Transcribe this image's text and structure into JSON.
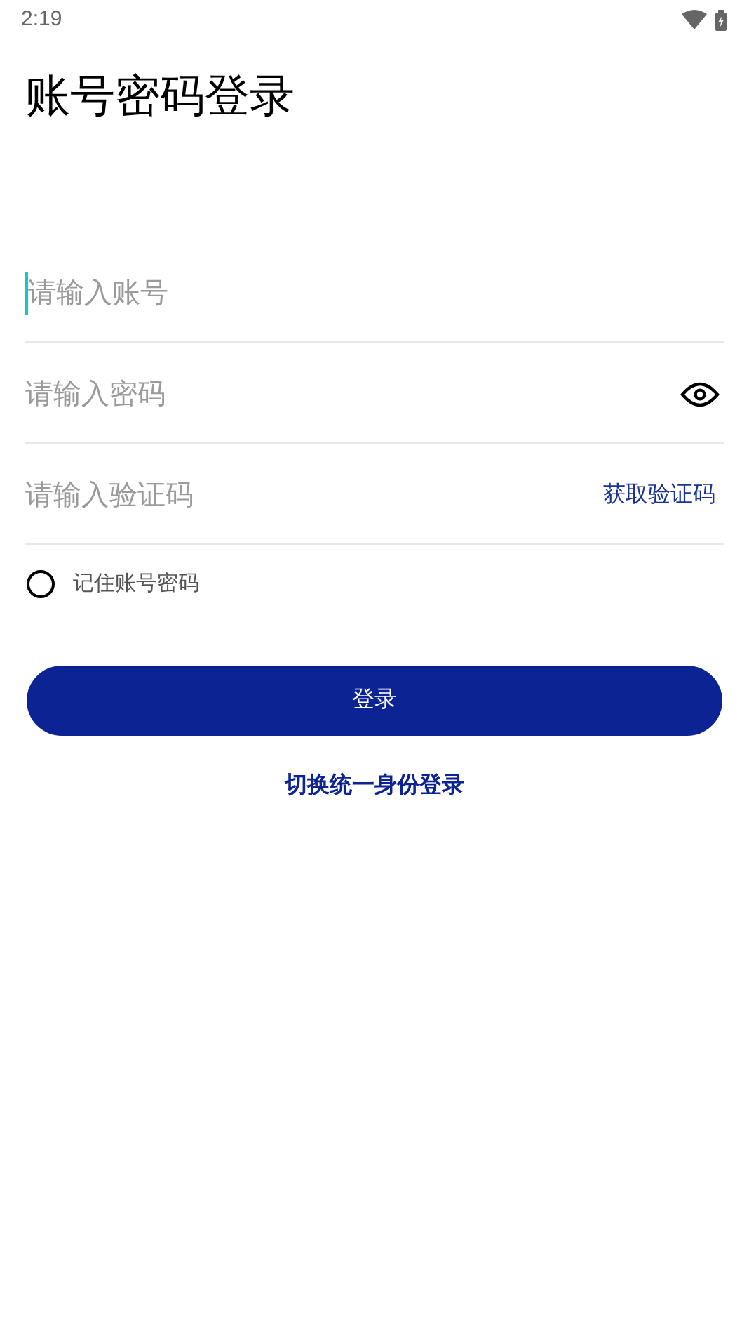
{
  "status_bar": {
    "time": "2:19"
  },
  "title": "账号密码登录",
  "fields": [
    {
      "kind": "account",
      "placeholder": "请输入账号",
      "focused": true
    },
    {
      "kind": "password",
      "placeholder": "请输入密码",
      "focused": false
    },
    {
      "kind": "code",
      "placeholder": "请输入验证码",
      "focused": false,
      "action": "获取验证码"
    }
  ],
  "remember": {
    "label": "记住账号密码",
    "checked": false
  },
  "login_button": "登录",
  "switch_link": "切换统一身份登录"
}
